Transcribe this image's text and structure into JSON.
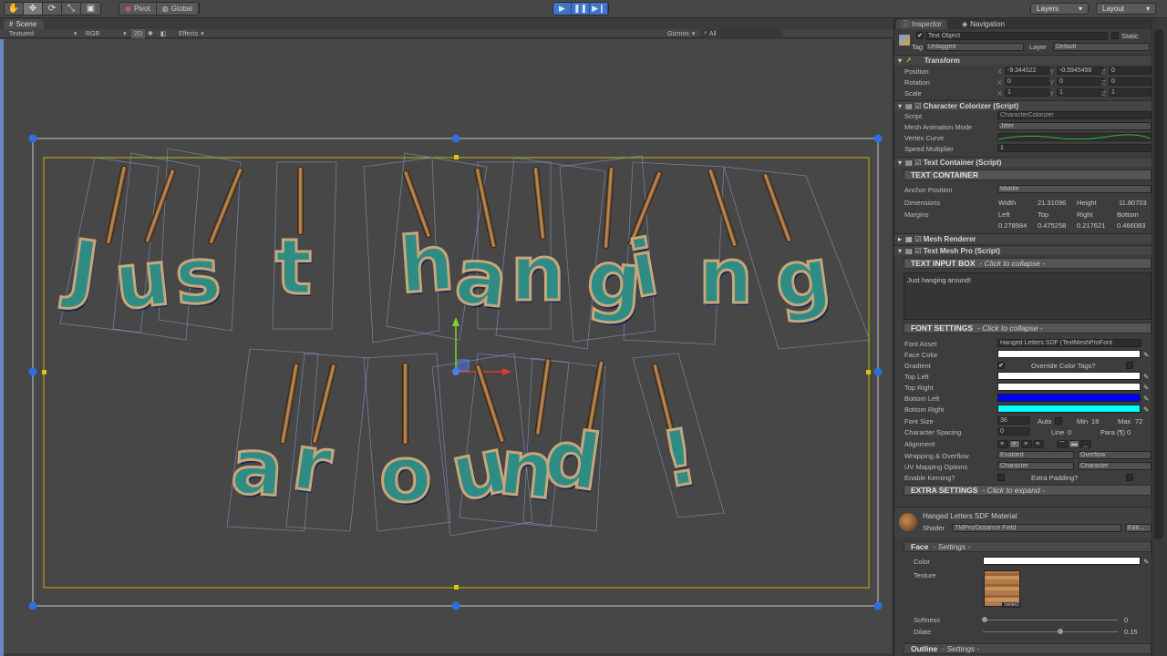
{
  "toolbar": {
    "pivot_label": "Pivot",
    "global_label": "Global",
    "layers_label": "Layers",
    "layout_label": "Layout"
  },
  "scene": {
    "tab_label": "Scene",
    "shading_mode": "Textured",
    "rgb_label": "RGB",
    "mode_2d": "2D",
    "effects_label": "Effects",
    "gizmos_label": "Gizmos",
    "search_placeholder": "All",
    "text_line1": [
      "J",
      "u",
      "s",
      "t",
      "h",
      "a",
      "n",
      "g",
      "i",
      "n",
      "g"
    ],
    "text_line2": [
      "a",
      "r",
      "o",
      "u",
      "n",
      "d",
      "!"
    ]
  },
  "inspector": {
    "tab_inspector": "Inspector",
    "tab_navigation": "Navigation",
    "object_name": "Text Object",
    "static_label": "Static",
    "tag_label": "Tag",
    "tag_value": "Untagged",
    "layer_label": "Layer",
    "layer_value": "Default",
    "transform": {
      "title": "Transform",
      "position_label": "Position",
      "rotation_label": "Rotation",
      "scale_label": "Scale",
      "position": {
        "x": "-9.344522",
        "y": "-0.5945456",
        "z": "0"
      },
      "rotation": {
        "x": "0",
        "y": "0",
        "z": "0"
      },
      "scale": {
        "x": "1",
        "y": "1",
        "z": "1"
      }
    },
    "colorizer": {
      "title": "Character Colorizer (Script)",
      "script_label": "Script",
      "script_value": "CharacterColorizer",
      "mesh_anim_label": "Mesh Animation Mode",
      "mesh_anim_value": "Jitter",
      "vertex_curve_label": "Vertex Curve",
      "speed_label": "Speed Multiplier",
      "speed_value": "1"
    },
    "container": {
      "title": "Text Container (Script)",
      "section": "TEXT CONTAINER",
      "anchor_label": "Anchor Position",
      "anchor_value": "Middle",
      "dimensions_label": "Dimensions",
      "width_label": "Width",
      "width_value": "21.31096",
      "height_label": "Height",
      "height_value": "11.80703",
      "margins_label": "Margins",
      "left_label": "Left",
      "top_label": "Top",
      "right_label": "Right",
      "bottom_label": "Bottom",
      "left_value": "0.278984",
      "top_value": "0.475258",
      "right_value": "0.217621",
      "bottom_value": "0.466083"
    },
    "mesh_renderer_title": "Mesh Renderer",
    "tmp": {
      "title": "Text Mesh Pro (Script)",
      "input_section": "TEXT INPUT BOX",
      "input_hint": "- Click to collapse -",
      "input_text": "Just hanging around!",
      "font_section": "FONT SETTINGS",
      "font_hint": "- Click to collapse -",
      "font_asset_label": "Font Asset",
      "font_asset_value": "Hanged Letters SDF (TextMeshProFont",
      "face_color_label": "Face Color",
      "gradient_label": "Gradient",
      "override_tags_label": "Override Color Tags?",
      "top_left_label": "Top Left",
      "top_right_label": "Top Right",
      "bottom_left_label": "Bottom Left",
      "bottom_right_label": "Bottom Right",
      "font_size_label": "Font Size",
      "font_size_value": "36",
      "auto_label": "Auto",
      "min_label": "Min",
      "min_value": "18",
      "max_label": "Max",
      "max_value": "72",
      "char_spacing_label": "Character Spacing",
      "char_spacing_value": "0",
      "line_label": "Line",
      "line_value": "0",
      "para_label": "Para (¶)",
      "para_value": "0",
      "alignment_label": "Alignment",
      "wrapping_label": "Wrapping & Overflow",
      "wrapping_value": "Enabled",
      "overflow_value": "Overflow",
      "uv_label": "UV Mapping Options",
      "uv_h_value": "Character",
      "uv_v_value": "Character",
      "kerning_label": "Enable Kerning?",
      "extra_padding_label": "Extra Padding?",
      "extra_section": "EXTRA SETTINGS",
      "extra_hint": "- Click to expand -"
    },
    "material": {
      "name": "Hanged Letters SDF Material",
      "shader_label": "Shader",
      "shader_value": "TMPro/Distance Field",
      "edit_label": "Edit...",
      "face_section": "Face",
      "face_hint": "- Settings -",
      "color_label": "Color",
      "texture_label": "Texture",
      "select_label": "Select",
      "softness_label": "Softness",
      "softness_value": "0",
      "dilate_label": "Dilate",
      "dilate_value": "0.15",
      "outline_section": "Outline",
      "outline_hint": "- Settings -"
    }
  },
  "colors": {
    "face": "#ffffff",
    "top_left": "#ffffff",
    "top_right": "#ffffff",
    "bottom_left": "#0000ff",
    "bottom_right": "#00ffff",
    "play_accent": "#3f74c6",
    "selection_handle": "#2f6fe0",
    "text_bounds": "#c8b400"
  }
}
